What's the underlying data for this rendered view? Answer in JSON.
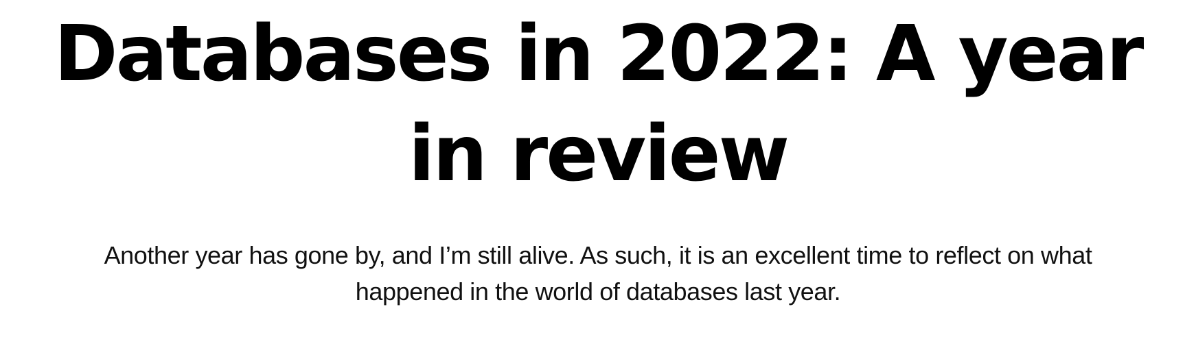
{
  "article": {
    "title": "Databases in 2022: A year in review",
    "subtitle": "Another year has gone by, and I’m still alive. As such, it is an excellent time to reflect on what happened in the world of databases last year."
  },
  "colors": {
    "background": "#ffffff",
    "text": "#000000"
  }
}
